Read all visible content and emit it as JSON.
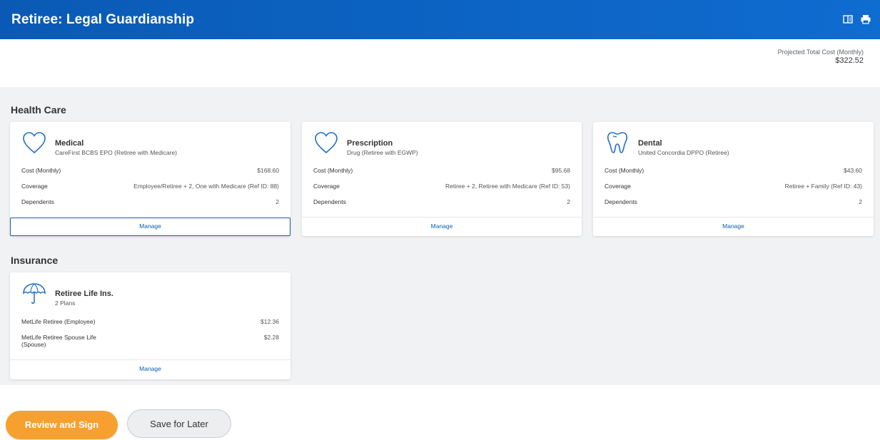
{
  "header": {
    "title": "Retiree: Legal Guardianship",
    "icons": [
      "layout-toggle-icon",
      "print-icon"
    ]
  },
  "projected": {
    "label": "Projected Total Cost (Monthly)",
    "value": "$322.52"
  },
  "sections": {
    "health_care": {
      "title": "Health Care",
      "cards": [
        {
          "icon": "heart-icon",
          "title": "Medical",
          "subtitle": "CareFirst BCBS EPO (Retiree with Medicare)",
          "rows": [
            {
              "label": "Cost (Monthly)",
              "value": "$168.60"
            },
            {
              "label": "Coverage",
              "value": "Employee/Retiree + 2, One with Medicare (Ref ID: 88)"
            },
            {
              "label": "Dependents",
              "value": "2"
            }
          ],
          "manage": "Manage"
        },
        {
          "icon": "heart-icon",
          "title": "Prescription",
          "subtitle": "Drug (Retiree with EGWP)",
          "rows": [
            {
              "label": "Cost (Monthly)",
              "value": "$95.68"
            },
            {
              "label": "Coverage",
              "value": "Retiree + 2, Retiree with Medicare (Ref ID: 53)"
            },
            {
              "label": "Dependents",
              "value": "2"
            }
          ],
          "manage": "Manage"
        },
        {
          "icon": "tooth-icon",
          "title": "Dental",
          "subtitle": "United Concordia DPPO (Retiree)",
          "rows": [
            {
              "label": "Cost (Monthly)",
              "value": "$43.60"
            },
            {
              "label": "Coverage",
              "value": "Retiree + Family (Ref ID: 43)"
            },
            {
              "label": "Dependents",
              "value": "2"
            }
          ],
          "manage": "Manage"
        }
      ]
    },
    "insurance": {
      "title": "Insurance",
      "cards": [
        {
          "icon": "umbrella-icon",
          "title": "Retiree Life Ins.",
          "subtitle": "2 Plans",
          "rows": [
            {
              "label": "MetLife Retiree (Employee)",
              "value": "$12.36"
            },
            {
              "label": "MetLife Retiree Spouse Life",
              "label2": "(Spouse)",
              "value": "$2.28"
            }
          ],
          "manage": "Manage"
        }
      ]
    }
  },
  "actions": {
    "primary": "Review and Sign",
    "secondary": "Save for Later"
  },
  "colors": {
    "header": "#0a5ab5",
    "link": "#0b5fb4",
    "primary_button": "#f7a030",
    "background_panel": "#f1f2f3"
  }
}
